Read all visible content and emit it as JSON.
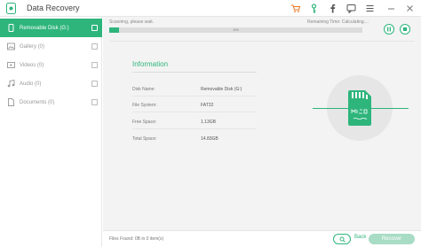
{
  "app": {
    "title": "Data Recovery"
  },
  "sidebar": {
    "items": [
      {
        "label": "Removable Disk (G:)",
        "icon": "phone-icon",
        "active": true
      },
      {
        "label": "Gallery (0)",
        "icon": "image-icon",
        "active": false
      },
      {
        "label": "Videos (0)",
        "icon": "video-icon",
        "active": false
      },
      {
        "label": "Audio (0)",
        "icon": "music-icon",
        "active": false
      },
      {
        "label": "Documents (0)",
        "icon": "document-icon",
        "active": false
      }
    ]
  },
  "scan": {
    "status": "Scanning, please wait.",
    "remaining": "Remaining Time: Calculating....",
    "progress_label": "0%",
    "progress": 0.04
  },
  "info": {
    "title": "Information",
    "rows": [
      {
        "label": "Disk Name:",
        "value": "Removable Disk (G:)"
      },
      {
        "label": "File System:",
        "value": "FAT32"
      },
      {
        "label": "Free Space:",
        "value": "1.13GB"
      },
      {
        "label": "Total Space:",
        "value": "14.83GB"
      }
    ]
  },
  "footer": {
    "files_found": "Files Found: 0B in 0 item(s)",
    "back_label": "Back",
    "recover_label": "Recover"
  },
  "colors": {
    "accent": "#2eb57c",
    "accent_light": "#a8dcc5",
    "toolbar_cart": "#e8731a"
  }
}
